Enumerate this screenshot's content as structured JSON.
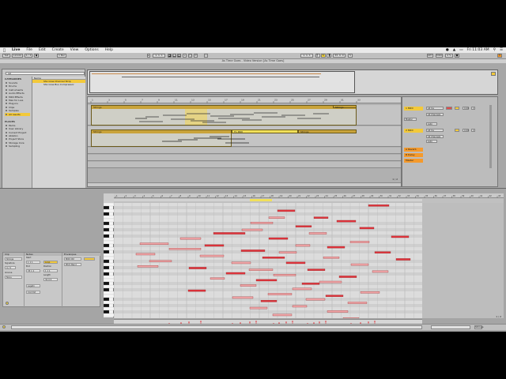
{
  "menubar": {
    "apple": "",
    "app_name": "Live",
    "menus": [
      "File",
      "Edit",
      "Create",
      "View",
      "Options",
      "Help"
    ],
    "clock": "Fri 11:03 AM"
  },
  "window": {
    "title": "As Time Goes - Video Version  [As Time Goes]"
  },
  "transport": {
    "tempo": "120.00",
    "signature": "4 / 4",
    "position": "1. 1. 1",
    "key": "KEY",
    "midi": "MIDI"
  },
  "browser": {
    "search_placeholder": "ssl",
    "categories_title": "CATEGORIES",
    "categories": [
      "Sounds",
      "Drums",
      "Instruments",
      "Audio Effects",
      "MIDI Effects",
      "Max for Live",
      "Plug-ins",
      "Clips",
      "Samples",
      "All results"
    ],
    "places_title": "PLACES",
    "places": [
      "Packs",
      "User Library",
      "Current Project",
      "Ableton",
      "Project Store",
      "Storage Core",
      "Sampling"
    ],
    "results_header": "Name",
    "results": [
      "SSL Glue Channel Strip",
      "SSL Glue Bus Compressor"
    ]
  },
  "arrangement": {
    "ruler_labels": [
      "1",
      "3",
      "5",
      "7",
      "9",
      "11",
      "13",
      "15",
      "17",
      "19",
      "21",
      "23",
      "25",
      "27",
      "29",
      "31",
      "33"
    ],
    "clips": [
      {
        "name": "Strings",
        "track": 0
      },
      {
        "name": "Strings",
        "track": 0
      },
      {
        "name": "Strings",
        "track": 1
      },
      {
        "name": "F1 MIDI",
        "track": 1
      },
      {
        "name": "Strings",
        "track": 1
      }
    ],
    "scroll_label": "1 / 2"
  },
  "mixer": {
    "tracks": [
      {
        "name": "1 MIDI",
        "input": "All Ins",
        "channel": "All Channels",
        "monitor": "Auto",
        "output": "Master",
        "volume": "0.00",
        "pan": "C"
      },
      {
        "name": "2 MIDI",
        "input": "All Ins",
        "channel": "All Channels",
        "monitor": "Auto",
        "output": "Master",
        "volume": "0.00",
        "pan": "C"
      }
    ],
    "returns": [
      "A Reverb",
      "B Delay",
      "Master"
    ]
  },
  "clip_props": {
    "clip_title": "Clip",
    "notes_title": "Notes",
    "envelopes_title": "Envelopes",
    "clip_name": "Strings",
    "signature": "4 / 4",
    "groove": "None",
    "start": "1  1  1",
    "end": "33  1  1",
    "loop": "Loop",
    "position": "1  1  1",
    "length": "32  0  0",
    "transpose_label": "Transpose",
    "legato": "Legato",
    "commit": "Commit",
    "device": "MIDI Ctrl",
    "control": "Pitch Bend"
  },
  "midi_editor": {
    "ruler_labels": [
      "1",
      "2",
      "3",
      "4",
      "5",
      "6",
      "7",
      "8",
      "9",
      "10",
      "11",
      "12",
      "13",
      "14",
      "15",
      "16",
      "17",
      "18",
      "19",
      "20",
      "21",
      "22",
      "23",
      "24",
      "25",
      "26",
      "27",
      "28",
      "29",
      "30",
      "31",
      "32",
      "33",
      "34",
      "35",
      "36",
      "37",
      "38",
      "39",
      "40",
      "41",
      "42",
      "43"
    ],
    "scroll_label": "1 / 2"
  },
  "status": {
    "text": "",
    "right_label": "Strings"
  },
  "colors": {
    "accent": "#f3c93a",
    "note_red": "#e0343c",
    "clip_gold": "#c9a33a",
    "loop_orange": "#f59a2b"
  }
}
